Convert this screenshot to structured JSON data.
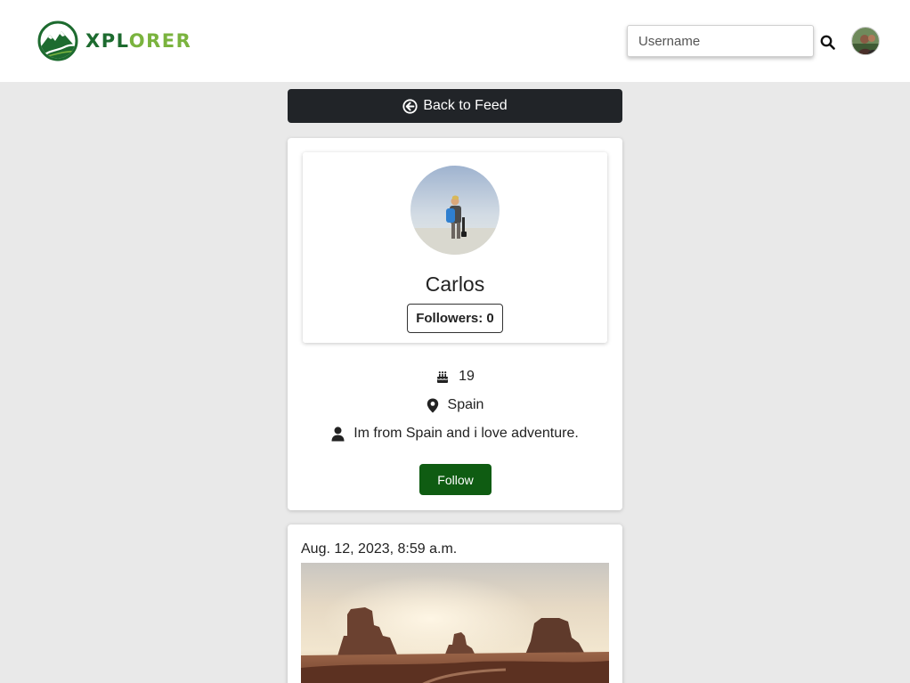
{
  "header": {
    "logo_text_a": "XPL",
    "logo_text_b": "ORER",
    "search_placeholder": "Username",
    "brand_colors": {
      "dark_green": "#1d6b2f",
      "light_green": "#7ab33e"
    }
  },
  "back_button": {
    "label": "Back to Feed",
    "icon": "arrow-circle-left-icon"
  },
  "profile": {
    "name": "Carlos",
    "followers_label": "Followers: 0",
    "age": "19",
    "country": "Spain",
    "bio": "Im from Spain and i love adventure.",
    "follow_label": "Follow",
    "icons": {
      "age": "birthday-cake-icon",
      "country": "map-marker-icon",
      "bio": "user-icon"
    }
  },
  "post": {
    "date": "Aug. 12, 2023, 8:59 a.m."
  },
  "colors": {
    "page_bg": "#e9e9e9",
    "back_button_bg": "#212428",
    "follow_button_bg": "#0f5c12"
  }
}
